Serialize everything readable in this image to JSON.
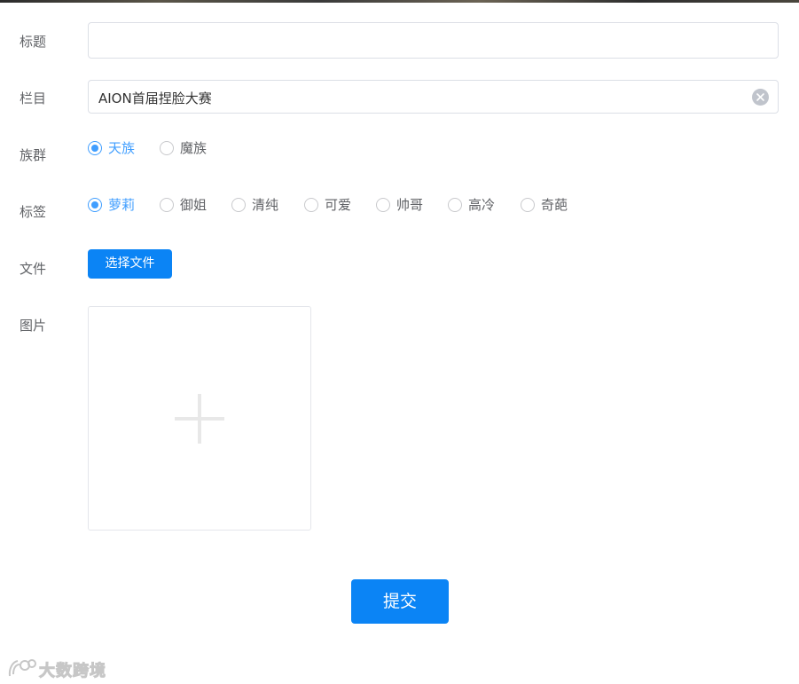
{
  "form": {
    "title_label": "标题",
    "title_value": "",
    "title_placeholder": "",
    "column_label": "栏目",
    "column_value": "AION首届捏脸大赛",
    "race_label": "族群",
    "race_options": [
      "天族",
      "魔族"
    ],
    "race_selected": "天族",
    "tag_label": "标签",
    "tag_options": [
      "萝莉",
      "御姐",
      "清纯",
      "可爱",
      "帅哥",
      "高冷",
      "奇葩"
    ],
    "tag_selected": "萝莉",
    "file_label": "文件",
    "file_button": "选择文件",
    "image_label": "图片",
    "submit_button": "提交"
  },
  "watermark": {
    "text": "大数跨境"
  },
  "colors": {
    "accent": "#409eff",
    "button": "#0b84f5",
    "label": "#606266",
    "border": "#dcdfe6"
  },
  "icons": {
    "clear": "circle-close-icon",
    "upload": "plus-icon",
    "logo": "watermark-logo-icon"
  }
}
